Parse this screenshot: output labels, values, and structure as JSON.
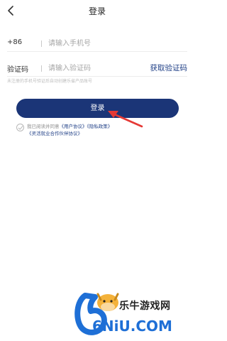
{
  "header": {
    "title": "登录",
    "back_icon": "chevron-left-icon"
  },
  "phone_row": {
    "prefix": "+86",
    "placeholder": "请输入手机号"
  },
  "code_row": {
    "label": "验证码",
    "placeholder": "请输入验证码",
    "get_code": "获取验证码"
  },
  "hint": "未注册的手机号验证后自动创建乐省产品账号",
  "login_button": "登录",
  "agreement": {
    "prefix": "我已阅读并同意",
    "user_agreement": "《用户协议》",
    "privacy_policy": "《隐私政策》",
    "partner_agreement": "《灵活就业合作伙伴协议》"
  },
  "watermark": {
    "text": "乐牛游戏网",
    "logo_text": "6NiU.COM"
  },
  "colors": {
    "primary": "#1b3577",
    "link": "#1f3f86",
    "arrow": "#e53935"
  }
}
